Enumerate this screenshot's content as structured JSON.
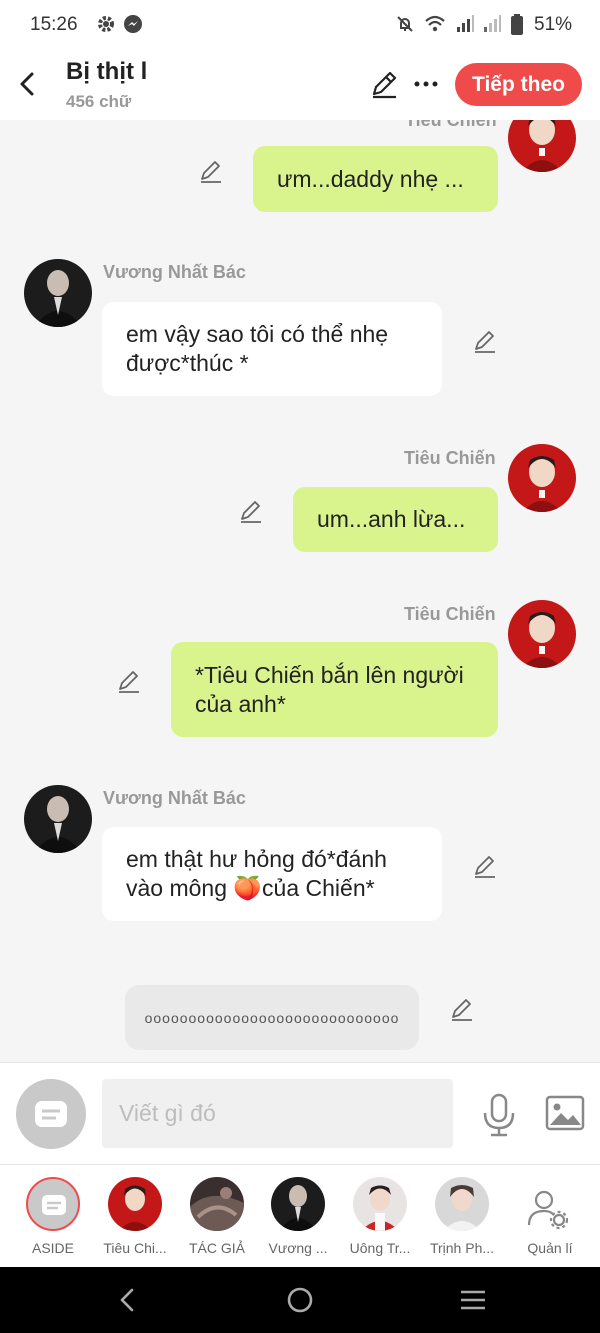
{
  "status_bar": {
    "time": "15:26",
    "battery": "51%"
  },
  "header": {
    "title": "Bị thịt l",
    "subtitle": "456 chữ",
    "next_label": "Tiếp theo"
  },
  "messages": [
    {
      "sender": "Tiêu Chiến",
      "text": "ưm...daddy nhẹ ...",
      "side": "right"
    },
    {
      "sender": "Vương Nhất Bác",
      "text": "em vậy sao tôi có thể nhẹ được*thúc *",
      "side": "left"
    },
    {
      "sender": "Tiêu Chiến",
      "text": "um...anh lừa...",
      "side": "right"
    },
    {
      "sender": "Tiêu Chiến",
      "text": "*Tiêu Chiến bắn lên người của anh*",
      "side": "right"
    },
    {
      "sender": "Vương Nhất Bác",
      "text_before": "em thật hư hỏng đó*đánh vào mông",
      "emoji": "🍑",
      "text_after": "của Chiến*",
      "side": "left"
    }
  ],
  "note": {
    "text": "ooooooooooooooooooooooooooooo"
  },
  "composer": {
    "placeholder": "Viết gì đó"
  },
  "characters": [
    {
      "label": "ASIDE"
    },
    {
      "label": "Tiêu Chi..."
    },
    {
      "label": "TÁC GIẢ"
    },
    {
      "label": "Vương ..."
    },
    {
      "label": "Uông Tr..."
    },
    {
      "label": "Trịnh Ph..."
    },
    {
      "label": "Quản lí"
    }
  ],
  "colors": {
    "accent": "#f04b4b",
    "my_bubble": "#d9f48d",
    "their_bubble": "#ffffff",
    "background": "#f5f5f5"
  },
  "icons": [
    "back-icon",
    "pencil-icon",
    "more-icon",
    "mic-icon",
    "image-icon",
    "settings-user-icon",
    "nav-back-icon",
    "nav-home-icon",
    "nav-menu-icon"
  ]
}
